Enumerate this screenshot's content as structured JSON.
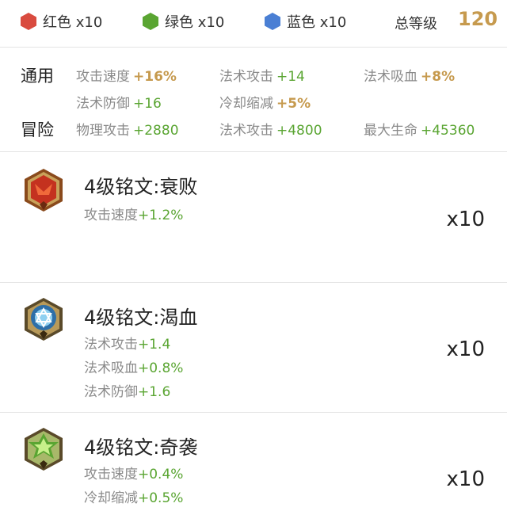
{
  "summary": {
    "colors": [
      {
        "label": "红色 x10",
        "color": "#d94b3f",
        "icon": "red-hexagon-icon"
      },
      {
        "label": "绿色 x10",
        "color": "#5aa532",
        "icon": "green-hexagon-icon"
      },
      {
        "label": "蓝色 x10",
        "color": "#4a7fd4",
        "icon": "blue-hexagon-icon"
      }
    ],
    "level_label": "总等级",
    "level_value": "120"
  },
  "stats": {
    "general_label": "通用",
    "adventure_label": "冒险",
    "general": [
      {
        "name": "攻击速度",
        "value": "+16%",
        "style": "gold"
      },
      {
        "name": "法术攻击",
        "value": "+14",
        "style": "green"
      },
      {
        "name": "法术吸血",
        "value": "+8%",
        "style": "gold"
      },
      {
        "name": "法术防御",
        "value": "+16",
        "style": "green"
      },
      {
        "name": "冷却缩减",
        "value": "+5%",
        "style": "gold"
      }
    ],
    "adventure": [
      {
        "name": "物理攻击",
        "value": "+2880",
        "style": "green"
      },
      {
        "name": "法术攻击",
        "value": "+4800",
        "style": "green"
      },
      {
        "name": "最大生命",
        "value": "+45360",
        "style": "green"
      }
    ]
  },
  "runes": [
    {
      "title": "4级铭文:衰败",
      "icon": "red-rune-icon",
      "count": "x10",
      "stats": [
        {
          "name": "攻击速度",
          "value": "+1.2%"
        }
      ]
    },
    {
      "title": "4级铭文:渴血",
      "icon": "blue-rune-icon",
      "count": "x10",
      "stats": [
        {
          "name": "法术攻击",
          "value": "+1.4"
        },
        {
          "name": "法术吸血",
          "value": "+0.8%"
        },
        {
          "name": "法术防御",
          "value": "+1.6"
        }
      ]
    },
    {
      "title": "4级铭文:奇袭",
      "icon": "green-rune-icon",
      "count": "x10",
      "stats": [
        {
          "name": "攻击速度",
          "value": "+0.4%"
        },
        {
          "name": "冷却缩减",
          "value": "+0.5%"
        }
      ]
    }
  ]
}
